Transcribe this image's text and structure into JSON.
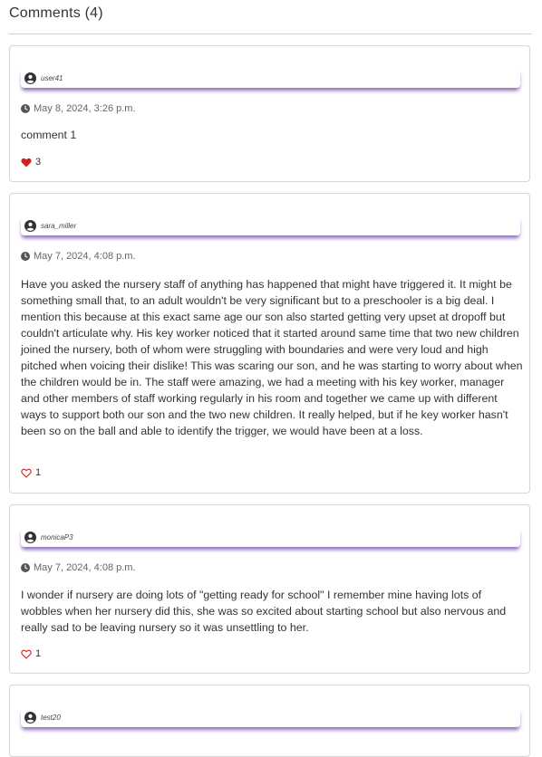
{
  "header": {
    "title": "Comments (4)"
  },
  "colors": {
    "accent_shadow": "#8a6bb8",
    "like_red": "#cc2222"
  },
  "comments": [
    {
      "username": "user41",
      "timestamp": "May 8, 2024, 3:26 p.m.",
      "body": "comment 1",
      "likes": "3",
      "liked": true
    },
    {
      "username": "sara_miller",
      "timestamp": "May 7, 2024, 4:08 p.m.",
      "body": "Have you asked the nursery staff of anything has happened that might have triggered it. It might be something small that, to an adult wouldn't be very significant but to a preschooler is a big deal. I mention this because at this exact same age our son also started getting very upset at dropoff but couldn't articulate why. His key worker noticed that it started around same time that two new children joined the nursery, both of whom were struggling with boundaries and were very loud and high pitched when voicing their dislike! This was scaring our son, and he was starting to worry about when the children would be in. The staff were amazing, we had a meeting with his key worker, manager and other members of staff working regularly in his room and together we came up with different ways to support both our son and the two new children. It really helped, but if he key worker hasn't been so on the ball and able to identify the trigger, we would have been at a loss.",
      "likes": "1",
      "liked": false
    },
    {
      "username": "monicaP3",
      "timestamp": "May 7, 2024, 4:08 p.m.",
      "body": "I wonder if nursery are doing lots of \"getting ready for school\" I remember mine having lots of wobbles when her nursery did this, she was so excited about starting school but also nervous and really sad to be leaving nursery so it was unsettling to her.",
      "likes": "1",
      "liked": false
    },
    {
      "username": "test20"
    }
  ],
  "icons": {
    "user": "user-avatar-icon",
    "clock": "clock-icon",
    "heart_filled": "heart-filled-icon",
    "heart_outline": "heart-outline-icon"
  }
}
